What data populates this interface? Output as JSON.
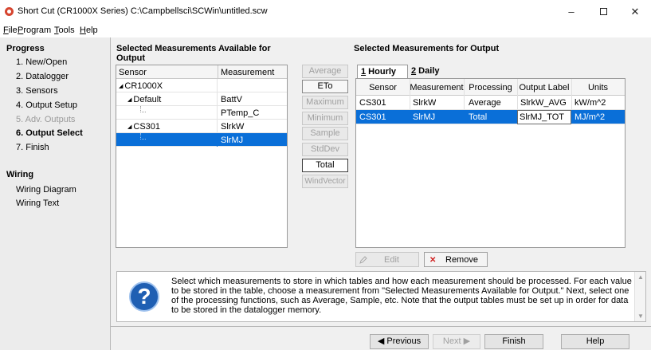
{
  "window": {
    "title": "Short Cut (CR1000X Series) C:\\Campbellsci\\SCWin\\untitled.scw",
    "min_glyph": "–",
    "close_glyph": "✕"
  },
  "menu": [
    {
      "accel": "F",
      "rest": "ile"
    },
    {
      "accel": "P",
      "rest": "rogram"
    },
    {
      "accel": "T",
      "rest": "ools"
    },
    {
      "accel": "H",
      "rest": "elp"
    }
  ],
  "sidebar": {
    "progress_heading": "Progress",
    "steps": [
      "1. New/Open",
      "2. Datalogger",
      "3. Sensors",
      "4. Output Setup",
      "5. Adv. Outputs",
      "6. Output Select",
      "7. Finish"
    ],
    "wiring_heading": "Wiring",
    "wiring_items": [
      "Wiring Diagram",
      "Wiring Text"
    ]
  },
  "available": {
    "title": "Selected Measurements Available for Output",
    "col_sensor": "Sensor",
    "col_measurement": "Measurement",
    "rows": [
      {
        "sensor": "CR1000X",
        "measurement": ""
      },
      {
        "sensor": "Default",
        "measurement": "BattV"
      },
      {
        "sensor": "",
        "measurement": "PTemp_C"
      },
      {
        "sensor": "CS301",
        "measurement": "SlrkW"
      },
      {
        "sensor": "",
        "measurement": "SlrMJ"
      }
    ]
  },
  "processing_buttons": [
    "Average",
    "ETo",
    "Maximum",
    "Minimum",
    "Sample",
    "StdDev",
    "Total",
    "WindVector"
  ],
  "output": {
    "title": "Selected Measurements for Output",
    "tabs": [
      {
        "accel": "1",
        "rest": " Hourly"
      },
      {
        "accel": "2",
        "rest": " Daily"
      }
    ],
    "columns": [
      "Sensor",
      "Measurement",
      "Processing",
      "Output Label",
      "Units"
    ],
    "rows": [
      {
        "sensor": "CS301",
        "measurement": "SlrkW",
        "processing": "Average",
        "label": "SlrkW_AVG",
        "units": "kW/m^2"
      },
      {
        "sensor": "CS301",
        "measurement": "SlrMJ",
        "processing": "Total",
        "label": "SlrMJ_TOT",
        "units": "MJ/m^2"
      }
    ],
    "edit_label": "Edit",
    "remove_label": "Remove"
  },
  "help": {
    "text": "Select which measurements to store in which tables and how each measurement should be processed. For each value to be stored in the table, choose a measurement from \"Selected Measurements Available for Output.\" Next, select one of the processing functions, such as Average, Sample, etc. Note that the output tables must be set up in order for data to be stored in the datalogger memory."
  },
  "nav": {
    "previous": "◀ Previous",
    "next": "Next ▶",
    "finish": "Finish",
    "help": "Help"
  },
  "colors": {
    "selection": "#0a6fd8",
    "app_icon": "#d6452f",
    "help_icon": "#1f5fb3"
  }
}
